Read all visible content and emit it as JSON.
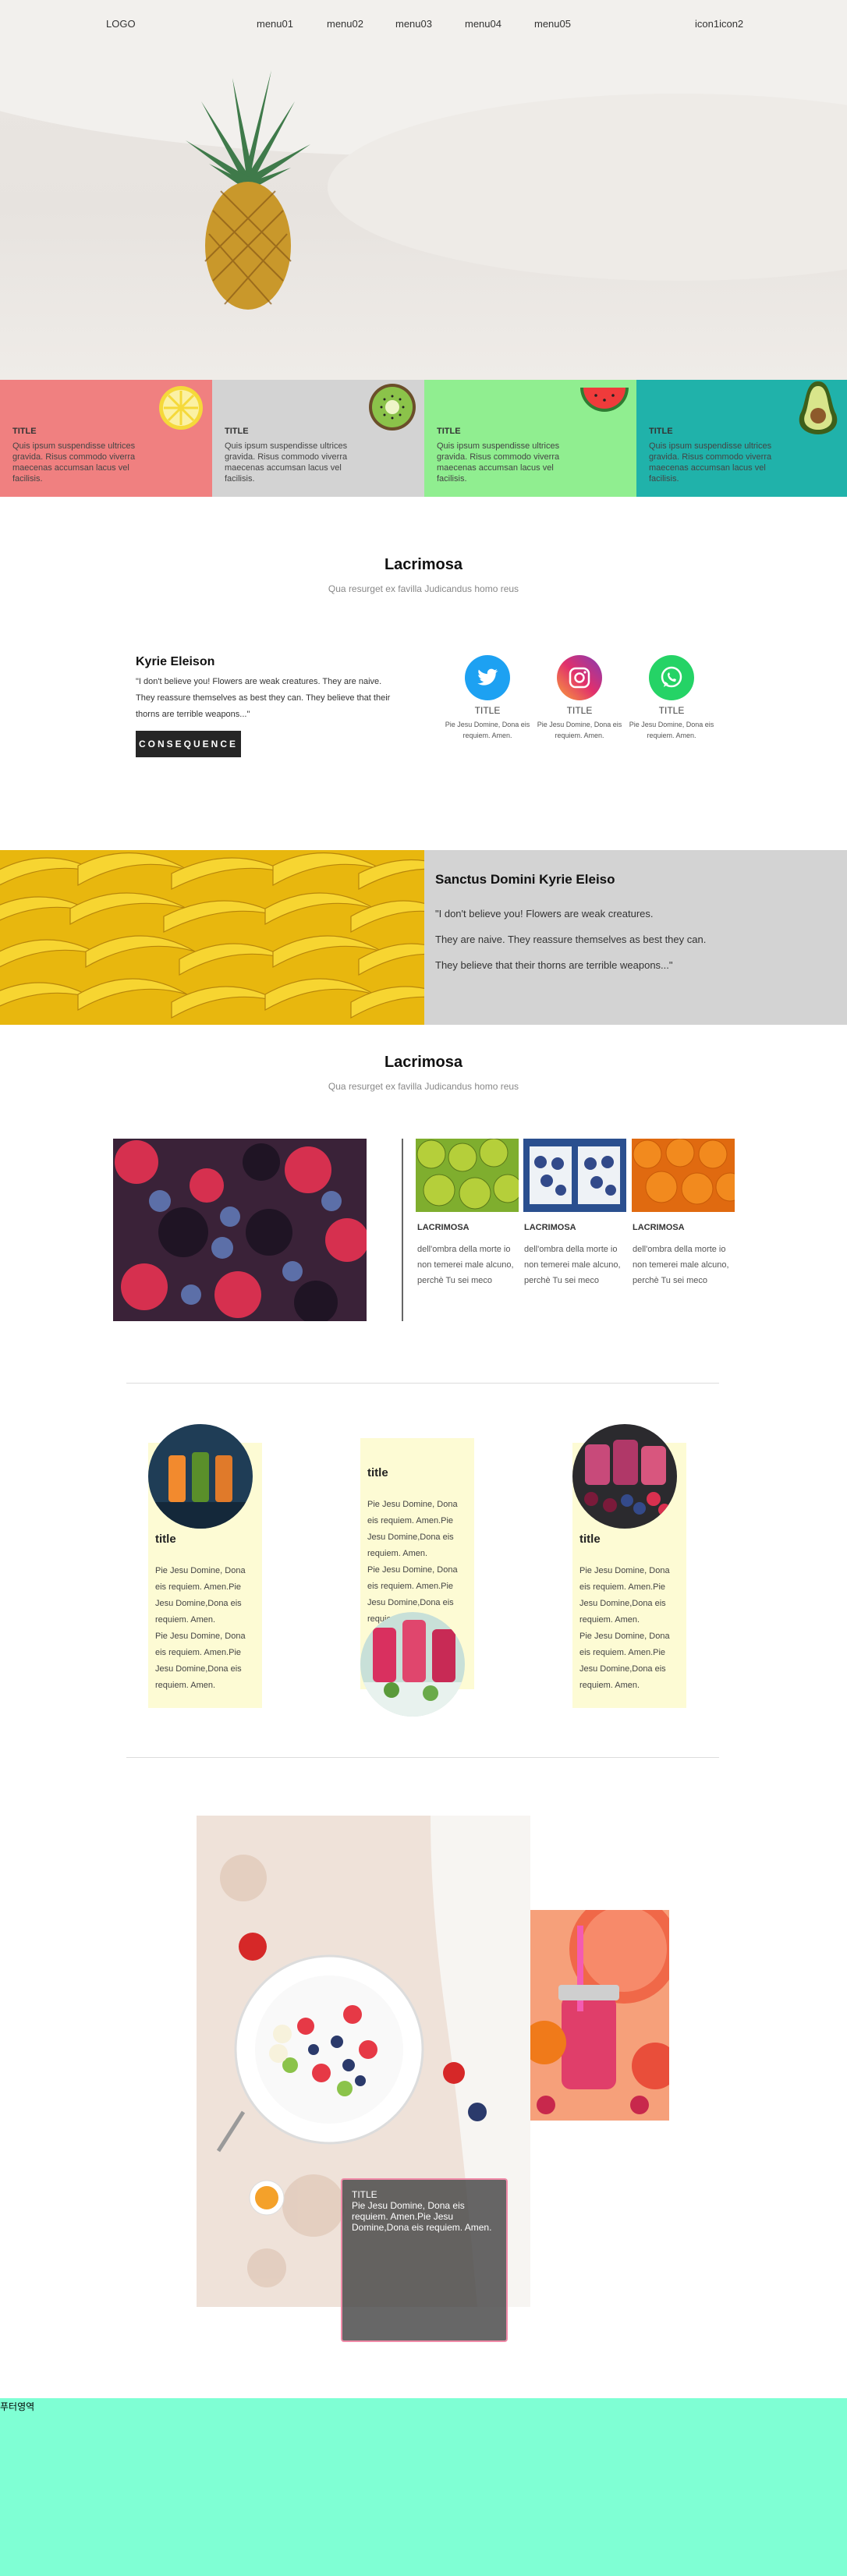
{
  "header": {
    "logo": "LOGO",
    "menu": [
      "menu01",
      "menu02",
      "menu03",
      "menu04",
      "menu05"
    ],
    "icons": "icon1icon2"
  },
  "cards": [
    {
      "title": "TITLE",
      "body": "Quis ipsum suspendisse ultrices gravida. Risus commodo viverra maecenas accumsan lacus vel facilisis.",
      "color": "#f08080",
      "fruit": "lemon-icon"
    },
    {
      "title": "TITLE",
      "body": "Quis ipsum suspendisse ultrices gravida. Risus commodo viverra maecenas accumsan lacus vel facilisis.",
      "color": "#d3d3d3",
      "fruit": "kiwi-icon"
    },
    {
      "title": "TITLE",
      "body": "Quis ipsum suspendisse ultrices gravida. Risus commodo viverra maecenas accumsan lacus vel facilisis.",
      "color": "#90ee90",
      "fruit": "watermelon-icon"
    },
    {
      "title": "TITLE",
      "body": "Quis ipsum suspendisse ultrices gravida. Risus commodo viverra maecenas accumsan lacus vel facilisis.",
      "color": "#20b2aa",
      "fruit": "avocado-icon"
    }
  ],
  "section1": {
    "title": "Lacrimosa",
    "subtitle": "Qua resurget ex favilla Judicandus homo reus",
    "kyrie": {
      "title": "Kyrie Eleison",
      "text": "\"I don't believe you! Flowers are weak creatures. They are naive. They reassure themselves as best they can. They believe that their thorns are terrible weapons...\"",
      "button": "CONSEQUENCE"
    },
    "social": [
      {
        "icon": "twitter-icon",
        "title": "TITLE",
        "body": "Pie Jesu Domine, Dona eis requiem. Amen."
      },
      {
        "icon": "instagram-icon",
        "title": "TITLE",
        "body": "Pie Jesu Domine, Dona eis requiem. Amen."
      },
      {
        "icon": "whatsapp-icon",
        "title": "TITLE",
        "body": "Pie Jesu Domine, Dona eis requiem. Amen."
      }
    ]
  },
  "sanctus": {
    "title": "Sanctus Domini Kyrie Eleiso",
    "lines": [
      "\"I don't believe you! Flowers are weak creatures.",
      "They are naive. They reassure themselves as best they can.",
      "They believe that their thorns are terrible weapons...\""
    ]
  },
  "section2": {
    "title": "Lacrimosa",
    "subtitle": "Qua resurget ex favilla Judicandus homo reus",
    "items": [
      {
        "title": "LACRIMOSA",
        "body": "dell'ombra della morte io non temerei male alcuno, perchè Tu sei meco",
        "image": "pears"
      },
      {
        "title": "LACRIMOSA",
        "body": "dell'ombra della morte io non temerei male alcuno, perchè Tu sei meco",
        "image": "blueberries"
      },
      {
        "title": "LACRIMOSA",
        "body": "dell'ombra della morte io non temerei male alcuno, perchè Tu sei meco",
        "image": "oranges"
      }
    ]
  },
  "ycards": [
    {
      "title": "title",
      "body": "Pie Jesu Domine, Dona eis requiem. Amen.Pie Jesu Domine,Dona eis requiem. Amen.\nPie Jesu Domine, Dona eis requiem. Amen.Pie Jesu Domine,Dona eis requiem. Amen."
    },
    {
      "title": "title",
      "body": "Pie Jesu Domine, Dona eis requiem. Amen.Pie Jesu Domine,Dona eis requiem. Amen.\nPie Jesu Domine, Dona eis requiem. Amen.Pie Jesu Domine,Dona eis requiem. Amen."
    },
    {
      "title": "title",
      "body": "Pie Jesu Domine, Dona eis requiem. Amen.Pie Jesu Domine,Dona eis requiem. Amen.\nPie Jesu Domine, Dona eis requiem. Amen.Pie Jesu Domine,Dona eis requiem. Amen."
    }
  ],
  "collage": {
    "overlay_title": "TITLE",
    "overlay_body": "Pie Jesu Domine, Dona eis requiem. Amen.Pie Jesu Domine,Dona eis requiem. Amen."
  },
  "footer": {
    "label": "푸터영역",
    "color": "#7fffd4"
  }
}
